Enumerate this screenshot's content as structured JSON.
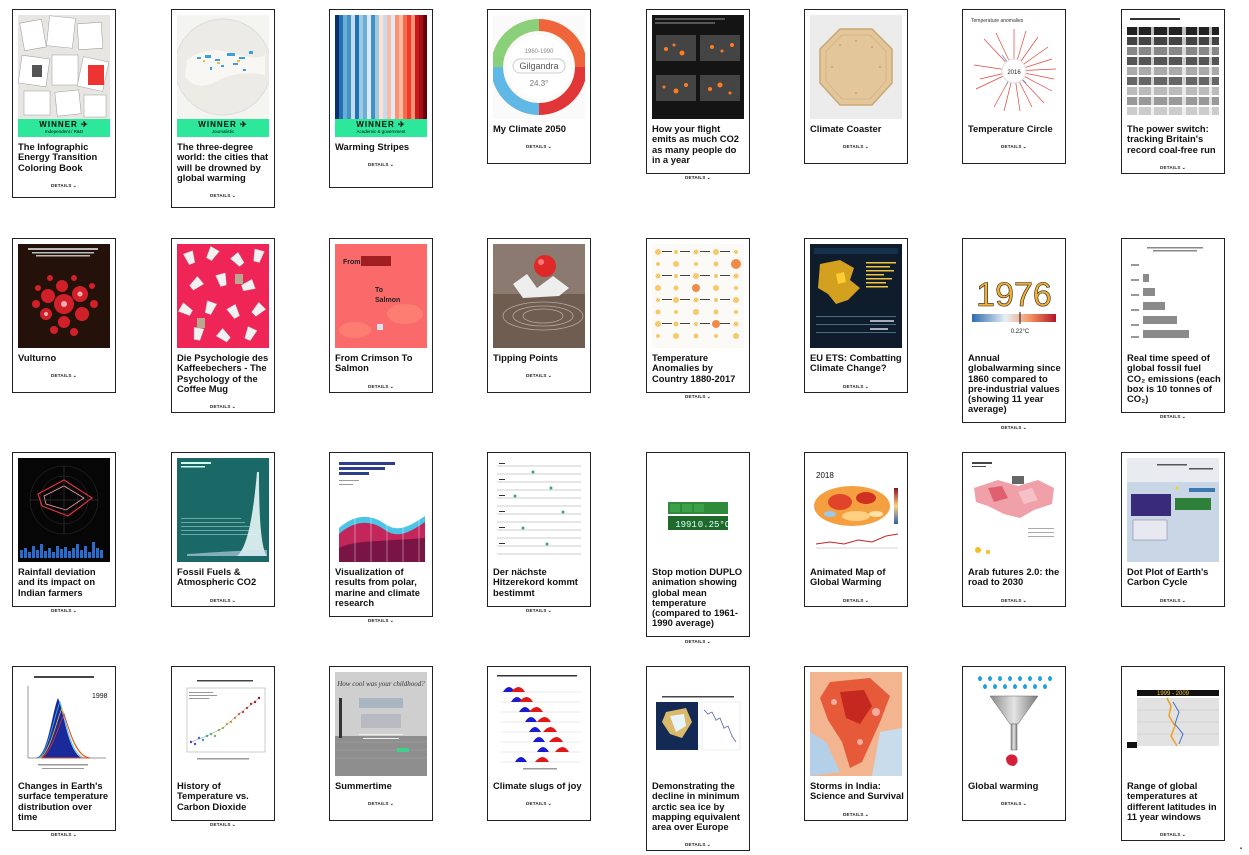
{
  "details_label": "DETAILS",
  "ribbon": {
    "winner": "WINNER",
    "sub_independent": "Independent / R&D",
    "sub_journalistic": "Journalistic",
    "sub_academic": "Academic & government"
  },
  "cards": [
    {
      "title": "The Infographic Energy Transition Coloring Book"
    },
    {
      "title": "The three-degree world: the cities that will be drowned by global warming"
    },
    {
      "title": "Warming Stripes"
    },
    {
      "title": "My Climate 2050",
      "thumb_text_a": "1960-1990",
      "thumb_text_b": "Gilgandra",
      "thumb_text_c": "24.3°"
    },
    {
      "title": "How your flight emits as much CO2 as many people do in a year"
    },
    {
      "title": "Climate Coaster"
    },
    {
      "title": "Temperature Circle",
      "thumb_text_a": "Temperature anomalies",
      "thumb_text_b": "2016"
    },
    {
      "title": "The power switch: tracking Britain's record coal-free run"
    },
    {
      "title": "Vulturno"
    },
    {
      "title": "Die Psychologie des Kaffeebechers - The Psychology of the Coffee Mug"
    },
    {
      "title": "From Crimson To Salmon",
      "thumb_text_a": "From",
      "thumb_text_b": "To",
      "thumb_text_c": "Salmon"
    },
    {
      "title": "Tipping Points"
    },
    {
      "title": "Temperature Anomalies by Country 1880-2017"
    },
    {
      "title": "EU ETS: Combatting Climate Change?"
    },
    {
      "title": "Annual globalwarming since 1860 compared to pre-industrial values (showing 11 year average)",
      "thumb_text_a": "1976",
      "thumb_text_b": "0.22°C"
    },
    {
      "title": "Real time speed of global fossil fuel CO₂ emissions (each box is 10 tonnes of CO₂)"
    },
    {
      "title": "Rainfall deviation and its impact on Indian farmers"
    },
    {
      "title": "Fossil Fuels & Atmospheric CO2"
    },
    {
      "title": "Visualization of results from polar, marine and climate research"
    },
    {
      "title": "Der nächste Hitzerekord kommt bestimmt"
    },
    {
      "title": "Stop motion DUPLO animation showing global mean temperature (compared to 1961-1990 average)",
      "thumb_text_a": "1991",
      "thumb_text_b": "0.25°C"
    },
    {
      "title": "Animated Map of Global Warming",
      "thumb_text_a": "2018"
    },
    {
      "title": "Arab futures 2.0: the road to 2030"
    },
    {
      "title": "Dot Plot of Earth's Carbon Cycle"
    },
    {
      "title": "Changes in Earth's surface temperature distribution over time",
      "thumb_text_a": "1998"
    },
    {
      "title": "History of Temperature vs. Carbon Dioxide"
    },
    {
      "title": "Summertime",
      "thumb_text_a": "How cool was your childhood?"
    },
    {
      "title": "Climate slugs of joy"
    },
    {
      "title": "Demonstrating the decline in minimum arctic sea ice by mapping equivalent area over Europe"
    },
    {
      "title": "Storms in India: Science and Survival"
    },
    {
      "title": "Global warming"
    },
    {
      "title": "Range of global temperatures at different latitudes in 11 year windows",
      "thumb_text_a": "1999 - 2009"
    }
  ]
}
